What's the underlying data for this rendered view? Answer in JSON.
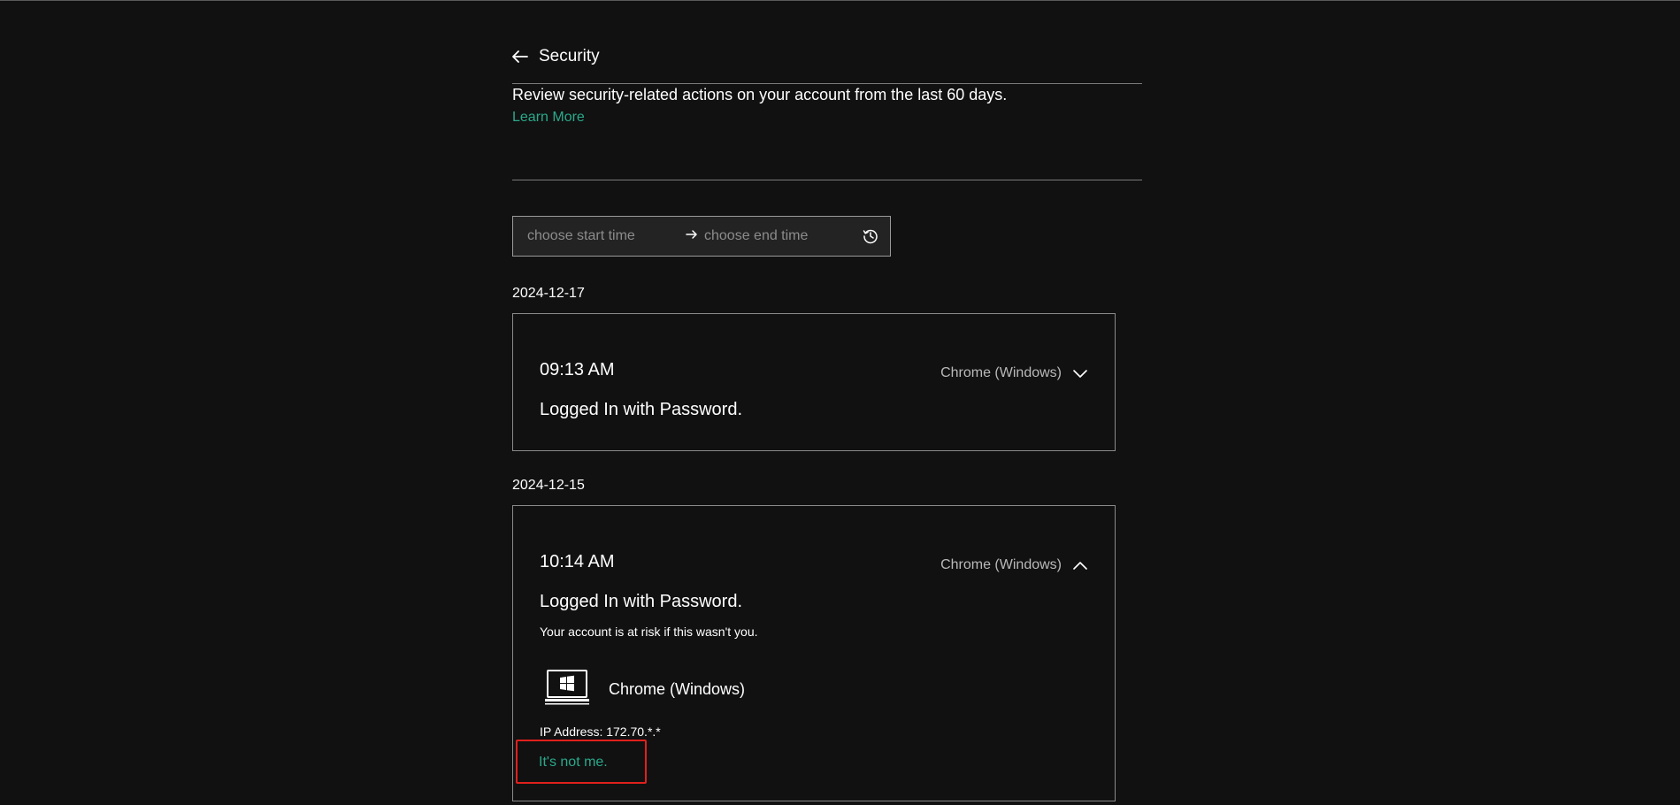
{
  "header": {
    "title": "Security"
  },
  "intro": {
    "description": "Review security-related actions on your account from the last 60 days.",
    "learn_more": "Learn More"
  },
  "date_filter": {
    "start_placeholder": "choose start time",
    "end_placeholder": "choose end time",
    "arrow_icon": "arrow-right-icon",
    "clock_icon": "history-clock-icon"
  },
  "groups": [
    {
      "date": "2024-12-17",
      "events": [
        {
          "time": "09:13 AM",
          "device": "Chrome (Windows)",
          "action": "Logged In with Password.",
          "expanded": false
        }
      ]
    },
    {
      "date": "2024-12-15",
      "events": [
        {
          "time": "10:14 AM",
          "device": "Chrome (Windows)",
          "action": "Logged In with Password.",
          "expanded": true,
          "details": {
            "risk_warning": "Your account is at risk if this wasn't you.",
            "device_name": "Chrome (Windows)",
            "ip_address": "IP Address: 172.70.*.*",
            "not_me_link": "It's not me."
          }
        }
      ]
    }
  ],
  "colors": {
    "background": "#111111",
    "accent": "#2aa98b",
    "highlight": "#e0201c"
  }
}
